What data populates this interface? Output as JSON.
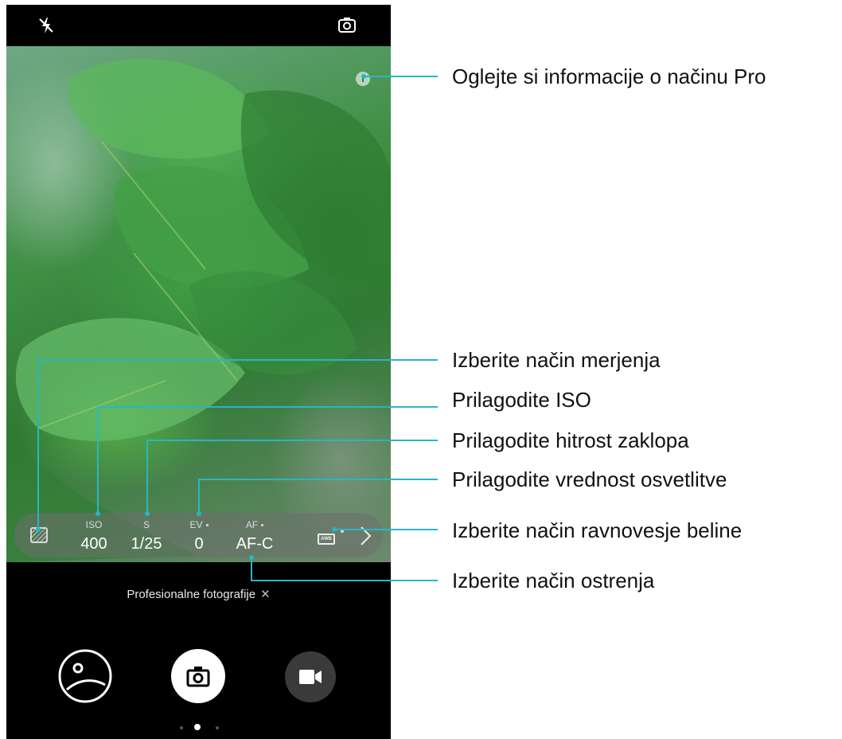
{
  "camera": {
    "mode_name": "Profesionalne fotografije",
    "mode_close_glyph": "✕",
    "info_glyph": "i",
    "parameters": [
      {
        "id": "metering",
        "icon": "metering-icon"
      },
      {
        "id": "iso",
        "label": "ISO",
        "value": "400"
      },
      {
        "id": "shutter",
        "label": "S",
        "value": "1/25"
      },
      {
        "id": "ev",
        "label": "EV",
        "value": "0"
      },
      {
        "id": "af",
        "label": "AF",
        "value": "AF-C"
      },
      {
        "id": "awb",
        "icon": "awb-icon",
        "text": "AWB"
      }
    ],
    "icons": [
      "flash-off-icon",
      "switch-camera-icon",
      "info-icon",
      "chevron-right-icon",
      "gallery-icon",
      "camera-icon",
      "video-icon"
    ],
    "pager": {
      "count": 3,
      "active": 2
    }
  },
  "callouts": [
    "Oglejte si informacije o načinu Pro",
    "Izberite način merjenja",
    "Prilagodite ISO",
    "Prilagodite hitrost zaklopa",
    "Prilagodite vrednost osvetlitve",
    "Izberite način ravnovesje beline",
    "Izberite način ostrenja"
  ],
  "colors": {
    "callout_line": "#28b6c4",
    "annotation_text": "#111111",
    "leaf_green": "#4caf50"
  }
}
